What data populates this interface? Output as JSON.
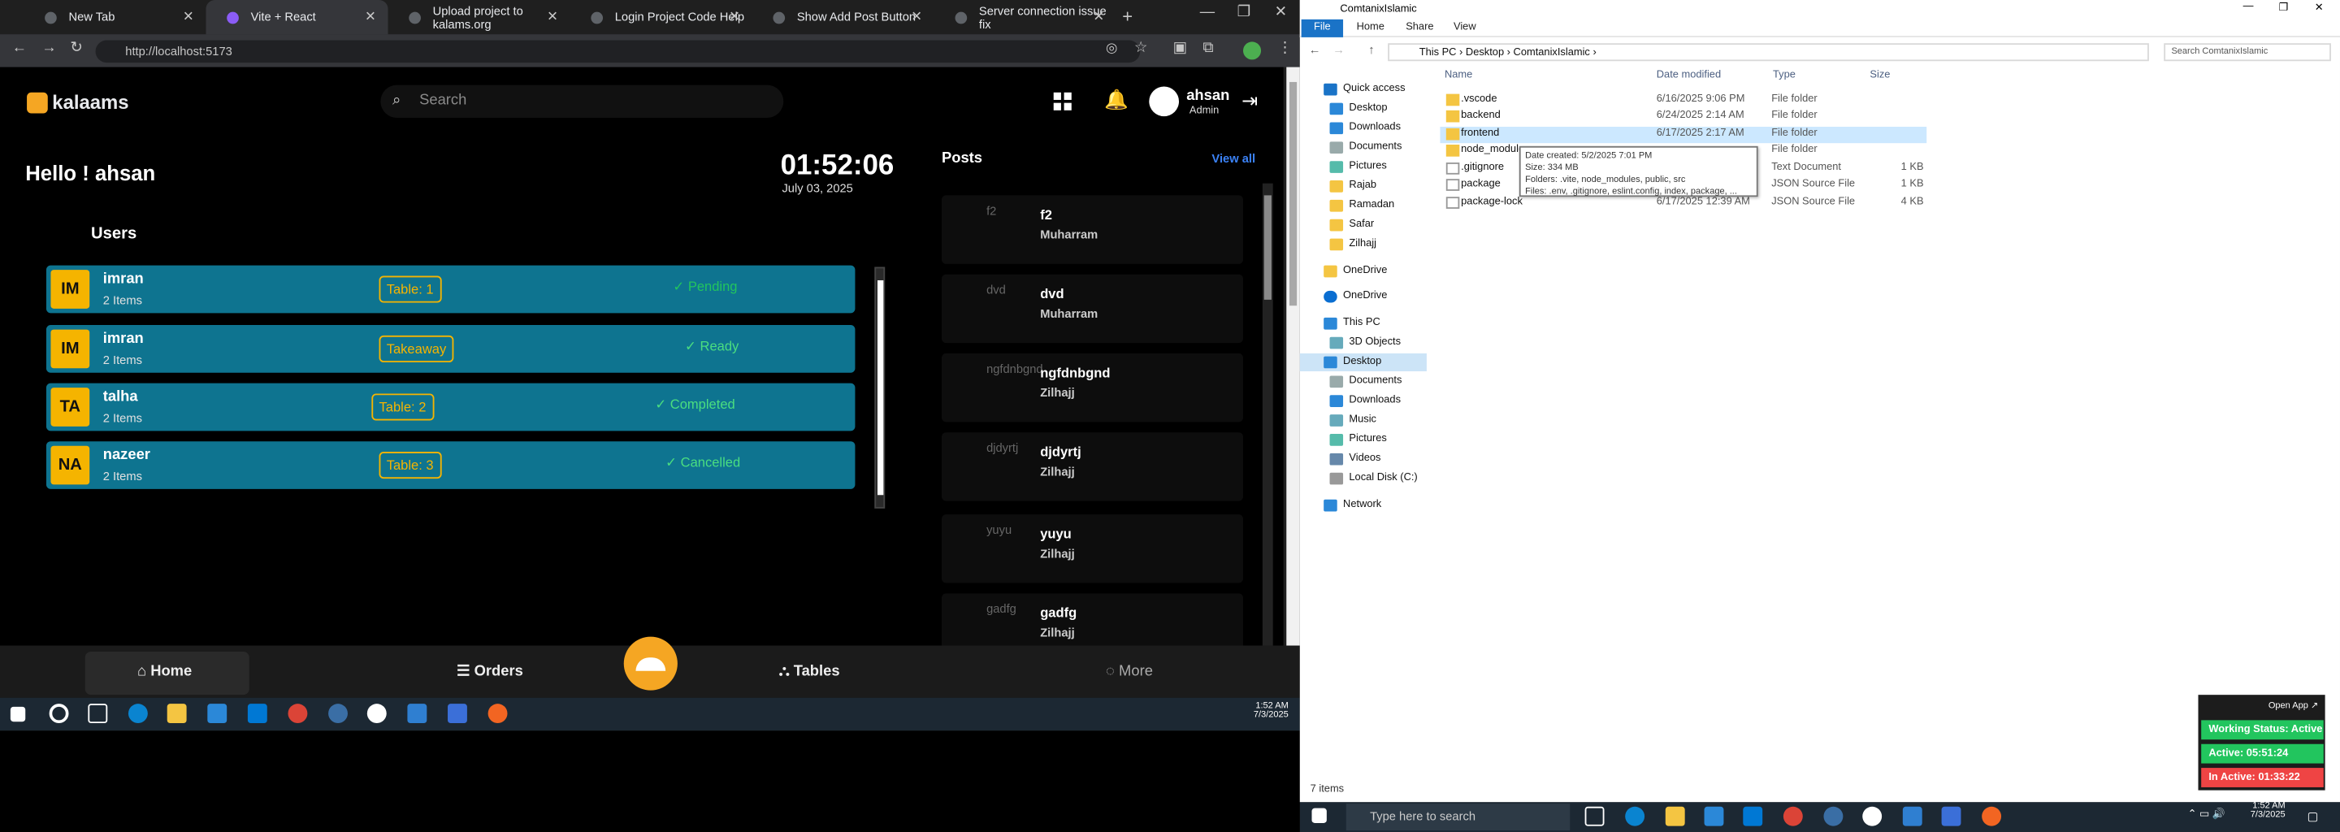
{
  "browser": {
    "tabs": [
      {
        "label": "New Tab"
      },
      {
        "label": "Vite + React"
      },
      {
        "label": "Upload project to kalams.org"
      },
      {
        "label": "Login Project Code Help"
      },
      {
        "label": "Show Add Post Button"
      },
      {
        "label": "Server connection issue fix"
      }
    ],
    "url": "http://localhost:5173"
  },
  "app": {
    "logo": "kalaams",
    "search_placeholder": "Search",
    "user": {
      "name": "ahsan",
      "role": "Admin"
    },
    "greeting": "Hello ! ahsan",
    "clock": "01:52:06",
    "date": "July 03, 2025",
    "users_title": "Users",
    "users": [
      {
        "initials": "IM",
        "name": "imran",
        "items": "2 Items",
        "table": "Table: 1",
        "status": "Pending"
      },
      {
        "initials": "IM",
        "name": "imran",
        "items": "2 Items",
        "table": "Takeaway",
        "status": "Ready"
      },
      {
        "initials": "TA",
        "name": "talha",
        "items": "2 Items",
        "table": "Table: 2",
        "status": "Completed"
      },
      {
        "initials": "NA",
        "name": "nazeer",
        "items": "2 Items",
        "table": "Table: 3",
        "status": "Cancelled"
      }
    ],
    "posts_title": "Posts",
    "view_all": "View all",
    "posts": [
      {
        "img_alt": "f2",
        "title": "f2",
        "sub": "Muharram"
      },
      {
        "img_alt": "dvd",
        "title": "dvd",
        "sub": "Muharram"
      },
      {
        "img_alt": "ngfdnbgnd",
        "title": "ngfdnbgnd",
        "sub": "Zilhajj"
      },
      {
        "img_alt": "djdyrtj",
        "title": "djdyrtj",
        "sub": "Zilhajj"
      },
      {
        "img_alt": "yuyu",
        "title": "yuyu",
        "sub": "Zilhajj"
      },
      {
        "img_alt": "gadfg",
        "title": "gadfg",
        "sub": "Zilhajj"
      }
    ],
    "bottom_nav": {
      "home": "Home",
      "orders": "Orders",
      "tables": "Tables",
      "more": "More"
    }
  },
  "left_taskbar": {
    "time": "1:52 AM",
    "date": "7/3/2025"
  },
  "explorer": {
    "title": "ComtanixIslamic",
    "ribbon": {
      "file": "File",
      "home": "Home",
      "share": "Share",
      "view": "View"
    },
    "breadcrumb": [
      "This PC",
      "Desktop",
      "ComtanixIslamic"
    ],
    "search_placeholder": "Search ComtanixIslamic",
    "sidebar": [
      "Quick access",
      "Desktop",
      "Downloads",
      "Documents",
      "Pictures",
      "Rajab",
      "Ramadan",
      "Safar",
      "Zilhajj",
      "OneDrive",
      "OneDrive",
      "This PC",
      "3D Objects",
      "Desktop",
      "Documents",
      "Downloads",
      "Music",
      "Pictures",
      "Videos",
      "Local Disk (C:)",
      "Network"
    ],
    "columns": {
      "name": "Name",
      "date": "Date modified",
      "type": "Type",
      "size": "Size"
    },
    "files": [
      {
        "name": ".vscode",
        "date": "6/16/2025 9:06 PM",
        "type": "File folder",
        "size": ""
      },
      {
        "name": "backend",
        "date": "6/24/2025 2:14 AM",
        "type": "File folder",
        "size": ""
      },
      {
        "name": "frontend",
        "date": "6/17/2025 2:17 AM",
        "type": "File folder",
        "size": ""
      },
      {
        "name": "node_modules",
        "date": "",
        "type": "File folder",
        "size": ""
      },
      {
        "name": ".gitignore",
        "date": "",
        "type": "Text Document",
        "size": "1 KB"
      },
      {
        "name": "package",
        "date": "",
        "type": "JSON Source File",
        "size": "1 KB"
      },
      {
        "name": "package-lock",
        "date": "6/17/2025 12:39 AM",
        "type": "JSON Source File",
        "size": "4 KB"
      }
    ],
    "tooltip": {
      "line1": "Date created: 5/2/2025 7:01 PM",
      "line2": "Size: 334 MB",
      "line3": "Folders: .vite, node_modules, public, src",
      "line4": "Files: .env, .gitignore, eslint.config, index, package, ..."
    },
    "item_count": "7 items"
  },
  "widget": {
    "open_app": "Open App",
    "working": "Working Status: Active",
    "active": "Active: 05:51:24",
    "inactive": "In Active: 01:33:22"
  },
  "right_taskbar": {
    "search_placeholder": "Type here to search",
    "time": "1:52 AM",
    "date": "7/3/2025"
  },
  "colors": {
    "accent": "#f5a623",
    "row_bg": "#0e7490",
    "status_green": "#4ade80",
    "explorer_blue": "#1a73c7"
  }
}
